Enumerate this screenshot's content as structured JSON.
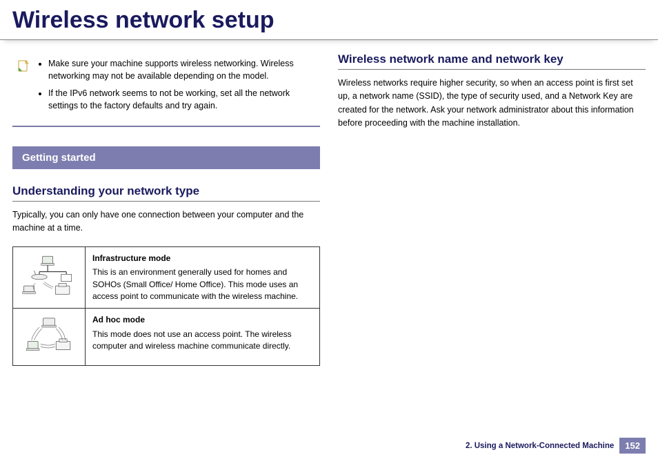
{
  "title": "Wireless network setup",
  "notes": [
    "Make sure your machine supports wireless networking. Wireless networking may not be available depending on the model.",
    "If the IPv6 network seems to not be working, set all the network settings to the factory defaults and try again."
  ],
  "section_band": "Getting started",
  "left": {
    "subhead": "Understanding your network type",
    "intro": "Typically, you can only have one connection between your computer and the machine at a time.",
    "modes": [
      {
        "title": "Infrastructure mode",
        "desc": "This is an environment generally used for homes and SOHOs (Small Office/ Home Office). This mode uses an access point to communicate with the wireless machine."
      },
      {
        "title": "Ad hoc mode",
        "desc": "This mode does not use an access point. The wireless computer and wireless machine communicate directly."
      }
    ]
  },
  "right": {
    "subhead": "Wireless network name and network key",
    "body": "Wireless networks require higher security, so when an access point is first set up, a network name (SSID), the type of security used, and a Network Key are created for the network. Ask your network administrator about this information before proceeding with the machine installation."
  },
  "footer": {
    "chapter": "2.  Using a Network-Connected Machine",
    "page": "152"
  }
}
